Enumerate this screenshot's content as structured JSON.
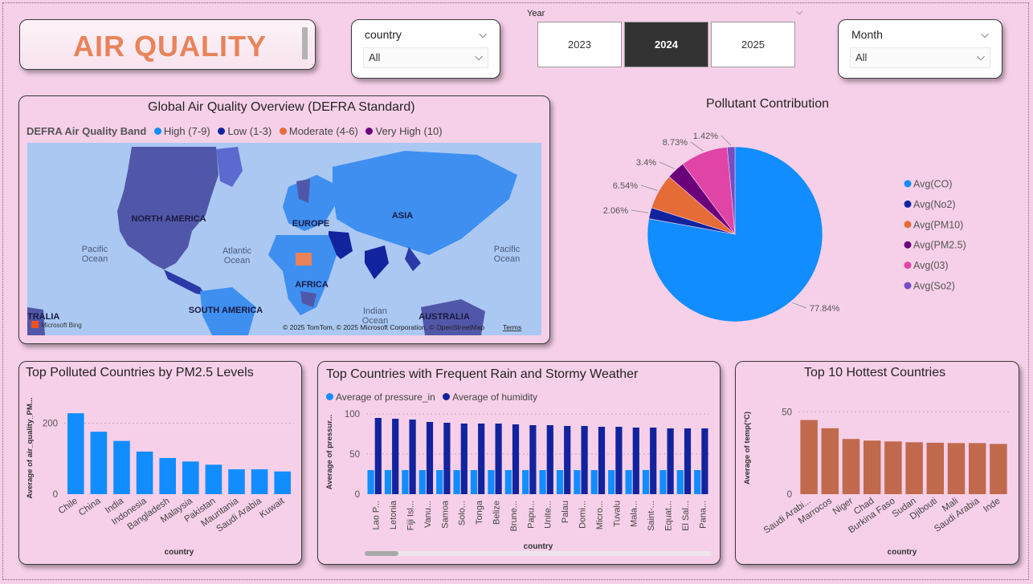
{
  "header": {
    "title": "AIR QUALITY"
  },
  "country_slicer": {
    "label": "country",
    "value": "All"
  },
  "month_slicer": {
    "label": "Month",
    "value": "All"
  },
  "year_slicer": {
    "label": "Year",
    "options": [
      "2023",
      "2024",
      "2025"
    ],
    "selected": "2024"
  },
  "map": {
    "title": "Global Air Quality Overview (DEFRA Standard)",
    "legend_title": "DEFRA Air Quality Band",
    "legend": [
      {
        "label": "High (7-9)",
        "color": "#118dff"
      },
      {
        "label": "Low (1-3)",
        "color": "#12239e"
      },
      {
        "label": "Moderate (4-6)",
        "color": "#e66c37"
      },
      {
        "label": "Very High (10)",
        "color": "#6b007b"
      }
    ],
    "labels": {
      "north_america": "NORTH AMERICA",
      "europe": "EUROPE",
      "asia": "ASIA",
      "africa": "AFRICA",
      "south_america": "SOUTH AMERICA",
      "australia": "AUSTRALIA",
      "australia_left": "TRALIA",
      "pacific_left": "Pacific\nOcean",
      "pacific_right": "Pacific\nOcean",
      "atlantic": "Atlantic\nOcean",
      "indian": "Indian\nOcean"
    },
    "attribution": "© 2025 TomTom, © 2025 Microsoft Corporation, © OpenStreetMap",
    "terms": "Terms",
    "bing": "Microsoft Bing"
  },
  "chart_data": [
    {
      "id": "pie",
      "type": "pie",
      "title": "Pollutant Contribution",
      "slices": [
        {
          "label": "Avg(CO)",
          "value": 77.84,
          "pct_label": "77.84%",
          "color": "#118dff"
        },
        {
          "label": "Avg(No2)",
          "value": 2.06,
          "pct_label": "2.06%",
          "color": "#12239e"
        },
        {
          "label": "Avg(PM10)",
          "value": 6.54,
          "pct_label": "6.54%",
          "color": "#e66c37"
        },
        {
          "label": "Avg(PM2.5)",
          "value": 3.4,
          "pct_label": "3.4%",
          "color": "#6b007b"
        },
        {
          "label": "Avg(03)",
          "value": 8.73,
          "pct_label": "8.73%",
          "color": "#e044a7"
        },
        {
          "label": "Avg(So2)",
          "value": 1.42,
          "pct_label": "1.42%",
          "color": "#744ec2"
        }
      ]
    },
    {
      "id": "pm25",
      "type": "bar",
      "title": "Top Polluted Countries by PM2.5 Levels",
      "xlabel": "country",
      "ylabel": "Average of air_quality_PM...",
      "yticks": [
        0,
        200
      ],
      "ylim": [
        0,
        260
      ],
      "color": "#118dff",
      "categories": [
        "Chile",
        "China",
        "India",
        "Indonesia",
        "Bangladesh",
        "Malaysia",
        "Pakistan",
        "Mauritania",
        "Saudi Arabia",
        "Kuwait"
      ],
      "values": [
        228,
        176,
        150,
        120,
        102,
        92,
        83,
        70,
        70,
        64
      ]
    },
    {
      "id": "rain",
      "type": "bar",
      "title": "Top Countries with Frequent Rain and Stormy Weather",
      "xlabel": "country",
      "ylabel": "Average of pressur...",
      "yticks": [
        0,
        50,
        100
      ],
      "ylim": [
        0,
        105
      ],
      "categories": [
        "Lao P...",
        "Letonia",
        "Fiji Isl...",
        "Vanu...",
        "Samoa",
        "Solo...",
        "Tonga",
        "Belize",
        "Brune...",
        "Papu...",
        "Unite...",
        "Palau",
        "Domi...",
        "Micro...",
        "Tuvalu",
        "Mala...",
        "Saint-...",
        "Equat...",
        "El Sal...",
        "Pana..."
      ],
      "series": [
        {
          "name": "Average of pressure_in",
          "color": "#118dff",
          "values": [
            30,
            30,
            30,
            30,
            30,
            30,
            30,
            30,
            30,
            30,
            30,
            30,
            30,
            30,
            30,
            30,
            30,
            30,
            30,
            30
          ]
        },
        {
          "name": "Average of humidity",
          "color": "#12239e",
          "values": [
            95,
            94,
            93,
            90,
            89,
            88,
            88,
            88,
            87,
            86,
            86,
            85,
            85,
            84,
            84,
            83,
            83,
            82,
            82,
            82
          ]
        }
      ]
    },
    {
      "id": "hot",
      "type": "bar",
      "title": "Top 10 Hottest Countries",
      "xlabel": "country",
      "ylabel": "Average of temp(°C)",
      "yticks": [
        0,
        50
      ],
      "ylim": [
        0,
        56
      ],
      "color": "#c0694c",
      "categories": [
        "Saudi Arabi...",
        "Marrocos",
        "Niger",
        "Chad",
        "Burkina Faso",
        "Sudan",
        "Djibouti",
        "Mali",
        "Saudi Arabia",
        "Inde"
      ],
      "values": [
        45,
        40,
        33.5,
        32.5,
        32,
        31.5,
        31.2,
        31,
        31,
        30.5
      ]
    }
  ]
}
